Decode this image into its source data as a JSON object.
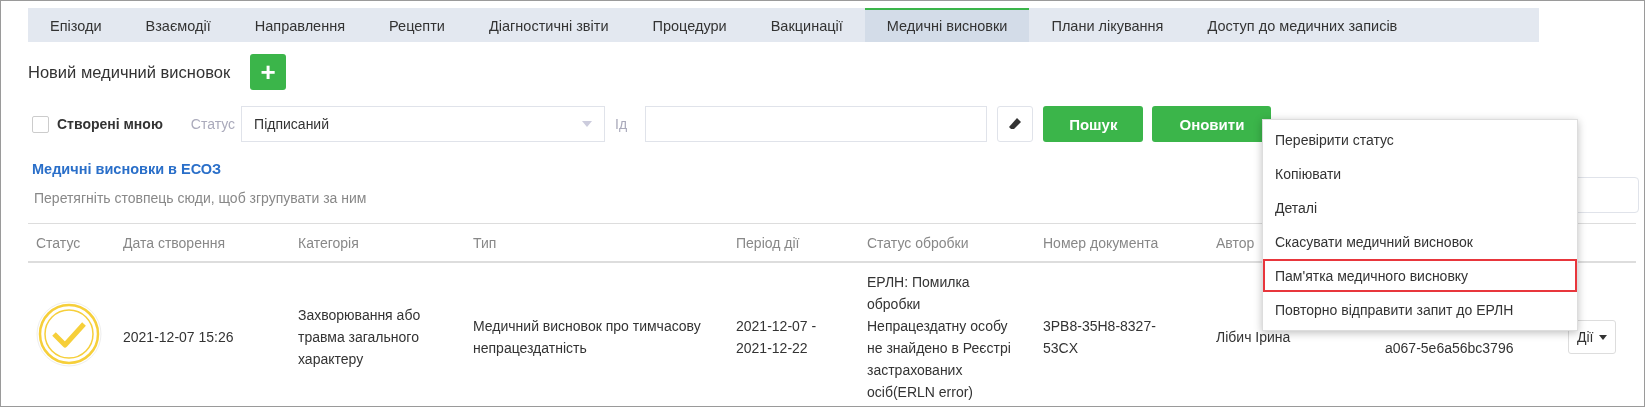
{
  "tabs": [
    {
      "label": "Епізоди",
      "selected": false
    },
    {
      "label": "Взаємодії",
      "selected": false
    },
    {
      "label": "Направлення",
      "selected": false
    },
    {
      "label": "Рецепти",
      "selected": false
    },
    {
      "label": "Діагностичні звіти",
      "selected": false
    },
    {
      "label": "Процедури",
      "selected": false
    },
    {
      "label": "Вакцинації",
      "selected": false
    },
    {
      "label": "Медичні висновки",
      "selected": true
    },
    {
      "label": "Плани лікування",
      "selected": false
    },
    {
      "label": "Доступ до медичних записів",
      "selected": false
    }
  ],
  "new_item": {
    "title": "Новий медичний висновок",
    "button": "+"
  },
  "filters": {
    "created_by_me": {
      "label": "Створені мною",
      "checked": false
    },
    "status": {
      "label": "Статус",
      "value": "Підписаний"
    },
    "id": {
      "label": "Ід"
    },
    "buttons": [
      "Пошук",
      "Оновити"
    ]
  },
  "section_link": "Медичні висновки в ЕСОЗ",
  "group_hint": "Перетягніть стовпець сюди, щоб згрупувати за ним",
  "table": {
    "columns": [
      "Статус",
      "Дата створення",
      "Категорія",
      "Тип",
      "Період дії",
      "Статус обробки",
      "Номер документа",
      "Автор"
    ],
    "rows": [
      {
        "color": "#f6cf3a",
        "date": "2021-12-07 15:26",
        "category": "Захворювання або травма загального характеру",
        "type": "Медичний висновок про тимчасову непрацездатність",
        "period": "2021-12-07 - 2021-12-22",
        "processing_status": "ЕРЛН: Помилка обробки Непрацездатну особу не знайдено в Реєстрі застрахованих осіб(ERLN error)",
        "document_number": "3PB8-35H8-8327-53CX",
        "author": "Лібич Ірина",
        "column_9": "a067-5e6a56bc3796",
        "actions": "Дії"
      }
    ]
  },
  "context_menu": [
    {
      "label": "Перевірити статус",
      "highlighted": false
    },
    {
      "label": "Копіювати",
      "highlighted": false
    },
    {
      "label": "Деталі",
      "highlighted": false
    },
    {
      "label": "Скасувати медичний висновок",
      "highlighted": false
    },
    {
      "label": "Пам'ятка медичного висновку",
      "highlighted": true
    },
    {
      "label": "Повторно відправити запит до ЕРЛН",
      "highlighted": false
    }
  ]
}
